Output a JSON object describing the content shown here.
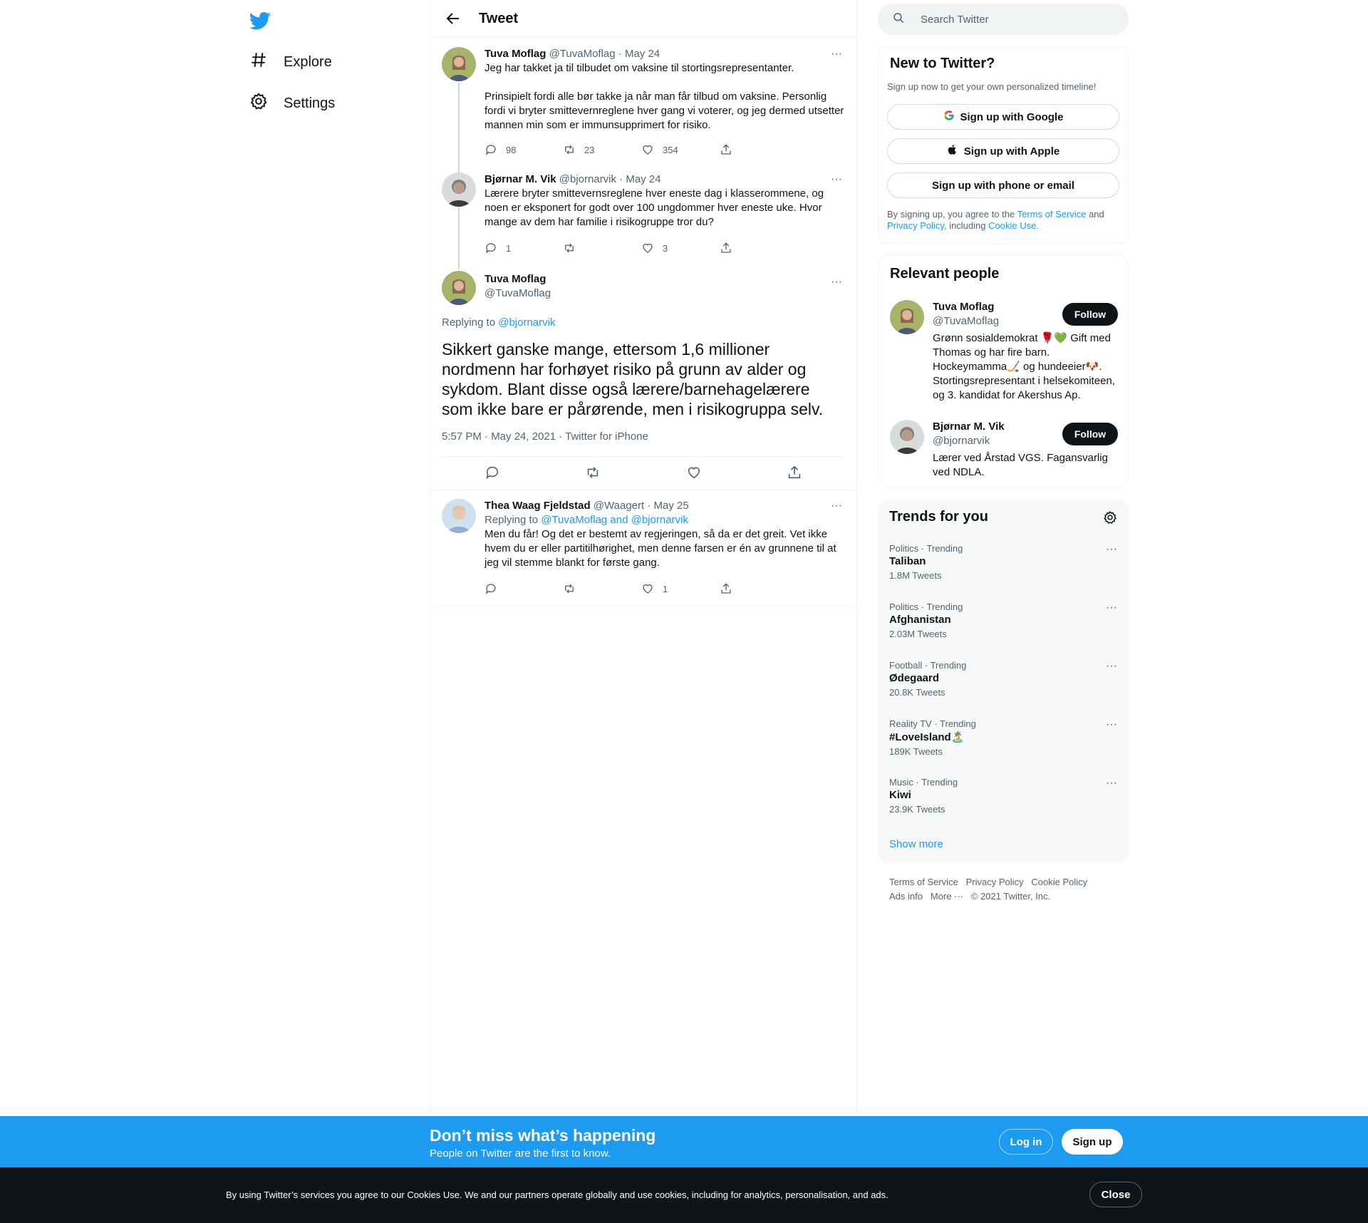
{
  "nav": {
    "items": [
      {
        "label": "Explore",
        "icon": "hashtag-icon"
      },
      {
        "label": "Settings",
        "icon": "gear-icon"
      }
    ]
  },
  "header": {
    "title": "Tweet"
  },
  "tweets": {
    "t1": {
      "name": "Tuva Moflag",
      "handle": "@TuvaMoflag",
      "date": "· May 24",
      "text": "Jeg har takket ja til tilbudet om vaksine til stortingsrepresentanter.\n\nPrinsipielt fordi alle bør takke ja når man får tilbud om vaksine. Personlig fordi vi bryter smittevernreglene hver gang vi voterer, og jeg dermed utsetter mannen min som er immunsupprimert for risiko.",
      "replies": "98",
      "retweets": "23",
      "likes": "354"
    },
    "t2": {
      "name": "Bjørnar M. Vik",
      "handle": "@bjornarvik",
      "date": "· May 24",
      "text": "Lærere bryter smittevernsreglene hver eneste dag i klasserommene, og noen er eksponert for godt over 100 ungdommer hver eneste uke. Hvor mange av dem har familie i risikogruppe tror du?",
      "replies": "1",
      "retweets": "",
      "likes": "3"
    },
    "main": {
      "name": "Tuva Moflag",
      "handle": "@TuvaMoflag",
      "replying_prefix": "Replying to",
      "replying_to": "@bjornarvik",
      "text": "Sikkert ganske mange, ettersom 1,6 millioner nordmenn har forhøyet risiko på grunn av alder og sykdom. Blant disse også lærere/barnehagelærere som ikke bare er pårørende, men i risikogruppa selv.",
      "meta": "5:57 PM · May 24, 2021 · Twitter for iPhone"
    },
    "t3": {
      "name": "Thea Waag Fjeldstad",
      "handle": "@Waagert",
      "date": "· May 25",
      "replying_prefix": "Replying to",
      "replying_to": "@TuvaMoflag and @bjornarvik",
      "text": "Men du får! Og det er bestemt av regjeringen, så da er det greit. Vet ikke hvem du er eller partitilhørighet, men denne farsen er én av grunnene til at jeg vil stemme blankt for første gang.",
      "replies": "",
      "retweets": "",
      "likes": "1"
    }
  },
  "search": {
    "placeholder": "Search Twitter"
  },
  "new_to_twitter": {
    "title": "New to Twitter?",
    "subtitle": "Sign up now to get your own personalized timeline!",
    "google": "Sign up with Google",
    "apple": "Sign up with Apple",
    "phone": "Sign up with phone or email",
    "legal_1": "By signing up, you agree to the",
    "tos": "Terms of Service",
    "and": "and",
    "privacy": "Privacy Policy",
    "including": ", including",
    "cookie": "Cookie Use."
  },
  "relevant": {
    "title": "Relevant people",
    "follow_label": "Follow",
    "people": [
      {
        "name": "Tuva Moflag",
        "handle": "@TuvaMoflag",
        "bio": "Grønn sosialdemokrat 🌹💚 Gift med Thomas og har fire barn. Hockeymamma🏒 og hundeeier🐶. Stortingsrepresentant i helsekomiteen, og 3. kandidat for Akershus Ap."
      },
      {
        "name": "Bjørnar M. Vik",
        "handle": "@bjornarvik",
        "bio": "Lærer ved Årstad VGS. Fagansvarlig ved NDLA."
      }
    ]
  },
  "trends": {
    "title": "Trends for you",
    "items": [
      {
        "category": "Politics · Trending",
        "name": "Taliban",
        "count": "1.8M Tweets"
      },
      {
        "category": "Politics · Trending",
        "name": "Afghanistan",
        "count": "2.03M Tweets"
      },
      {
        "category": "Football · Trending",
        "name": "Ødegaard",
        "count": "20.8K Tweets"
      },
      {
        "category": "Reality TV · Trending",
        "name": "#LoveIsland🏝️",
        "count": "189K Tweets"
      },
      {
        "category": "Music · Trending",
        "name": "Kiwi",
        "count": "23.9K Tweets"
      }
    ],
    "show_more": "Show more"
  },
  "footer": {
    "links": [
      "Terms of Service",
      "Privacy Policy",
      "Cookie Policy",
      "Ads info",
      "More ···",
      "© 2021 Twitter, Inc."
    ]
  },
  "signup_bar": {
    "title": "Don’t miss what’s happening",
    "subtitle": "People on Twitter are the first to know.",
    "login": "Log in",
    "signup": "Sign up"
  },
  "cookie_bar": {
    "text": "By using Twitter’s services you agree to our Cookies Use. We and our partners operate globally and use cookies, including for analytics, personalisation, and ads.",
    "close": "Close"
  },
  "colors": {
    "accent": "#1d9bf0",
    "text": "#0f1419",
    "muted": "#536471",
    "border": "#eff3f4"
  }
}
